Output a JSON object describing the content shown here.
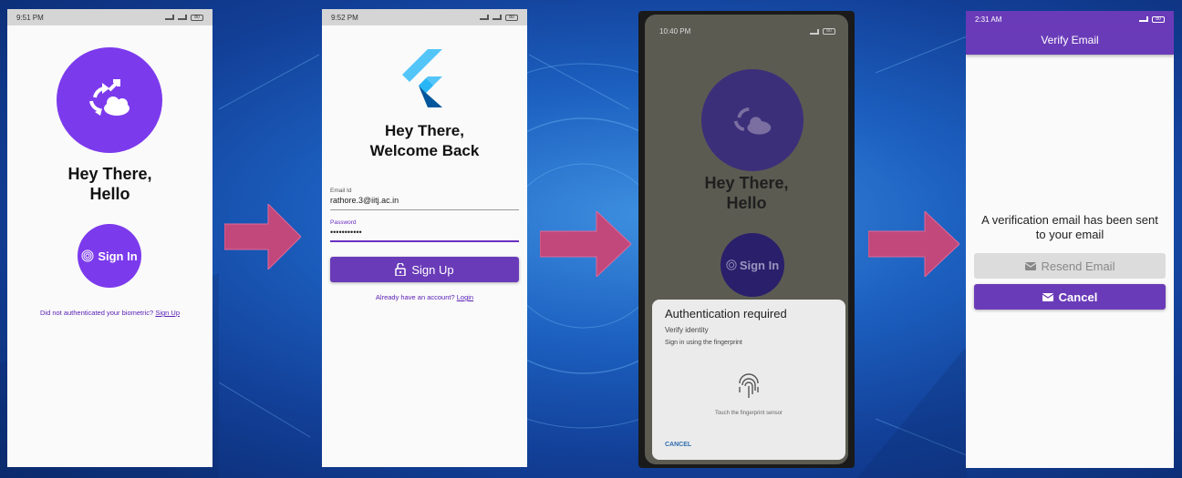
{
  "colors": {
    "accent": "#7c3aed",
    "button": "#6a3bb8",
    "arrow": "#c2477a"
  },
  "screen1": {
    "status_time": "9:51 PM",
    "battery": "80",
    "heading_line1": "Hey There,",
    "heading_line2": "Hello",
    "signin_label": "Sign In",
    "footer_text": "Did not authenticated your biometric?",
    "footer_link": "Sign Up",
    "icons": [
      "sync-cloud-icon",
      "fingerprint-icon"
    ]
  },
  "screen2": {
    "status_time": "9:52 PM",
    "battery": "80",
    "heading_line1": "Hey There,",
    "heading_line2": "Welcome Back",
    "email_label": "Email Id",
    "email_value": "rathore.3@iitj.ac.in",
    "password_label": "Password",
    "password_value": "•••••••••••",
    "signup_label": "Sign Up",
    "footer_text": "Already have an account?",
    "footer_link": "Login",
    "icons": [
      "flutter-logo-icon",
      "lock-open-icon"
    ]
  },
  "screen3": {
    "status_time": "10:40 PM",
    "battery": "80",
    "heading_line1": "Hey There,",
    "heading_line2": "Hello",
    "signin_label": "Sign In",
    "auth_title": "Authentication required",
    "auth_subtitle": "Verify identity",
    "auth_description": "Sign in using the fingerprint",
    "auth_hint": "Touch the fingerprint sensor",
    "auth_cancel": "CANCEL"
  },
  "screen4": {
    "status_time": "2:31 AM",
    "battery": "80",
    "appbar_title": "Verify Email",
    "message_line1": "A verification email has been sent",
    "message_line2": "to your email",
    "resend_label": "Resend Email",
    "cancel_label": "Cancel",
    "icons": [
      "mail-icon"
    ]
  }
}
